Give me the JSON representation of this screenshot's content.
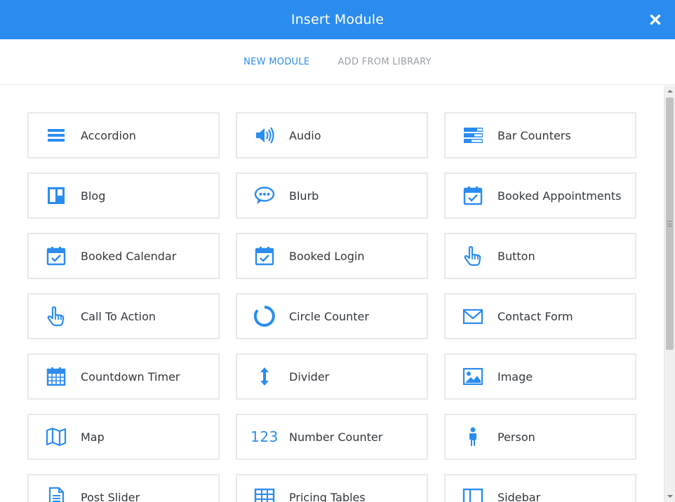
{
  "dialog": {
    "title": "Insert Module",
    "close_icon": "close-icon"
  },
  "tabs": [
    {
      "label": "NEW MODULE",
      "active": true
    },
    {
      "label": "ADD FROM LIBRARY",
      "active": false
    }
  ],
  "colors": {
    "accent": "#2b8cf0",
    "border": "#e7e9ec",
    "text": "#32373c",
    "inactive_tab": "#9aa0a6"
  },
  "modules": [
    {
      "label": "Accordion",
      "icon": "accordion-icon"
    },
    {
      "label": "Audio",
      "icon": "audio-icon"
    },
    {
      "label": "Bar Counters",
      "icon": "bar-counters-icon"
    },
    {
      "label": "Blog",
      "icon": "blog-icon"
    },
    {
      "label": "Blurb",
      "icon": "blurb-icon"
    },
    {
      "label": "Booked Appointments",
      "icon": "calendar-check-icon"
    },
    {
      "label": "Booked Calendar",
      "icon": "calendar-check-icon"
    },
    {
      "label": "Booked Login",
      "icon": "calendar-check-icon"
    },
    {
      "label": "Button",
      "icon": "pointer-hand-icon"
    },
    {
      "label": "Call To Action",
      "icon": "pointer-hand-icon"
    },
    {
      "label": "Circle Counter",
      "icon": "circle-counter-icon"
    },
    {
      "label": "Contact Form",
      "icon": "envelope-icon"
    },
    {
      "label": "Countdown Timer",
      "icon": "calendar-grid-icon"
    },
    {
      "label": "Divider",
      "icon": "vertical-arrows-icon"
    },
    {
      "label": "Image",
      "icon": "image-icon"
    },
    {
      "label": "Map",
      "icon": "map-icon"
    },
    {
      "label": "Number Counter",
      "icon": "number-counter-icon",
      "icon_text": "123"
    },
    {
      "label": "Person",
      "icon": "person-icon"
    },
    {
      "label": "Post Slider",
      "icon": "document-icon"
    },
    {
      "label": "Pricing Tables",
      "icon": "table-icon"
    },
    {
      "label": "Sidebar",
      "icon": "sidebar-icon"
    }
  ]
}
